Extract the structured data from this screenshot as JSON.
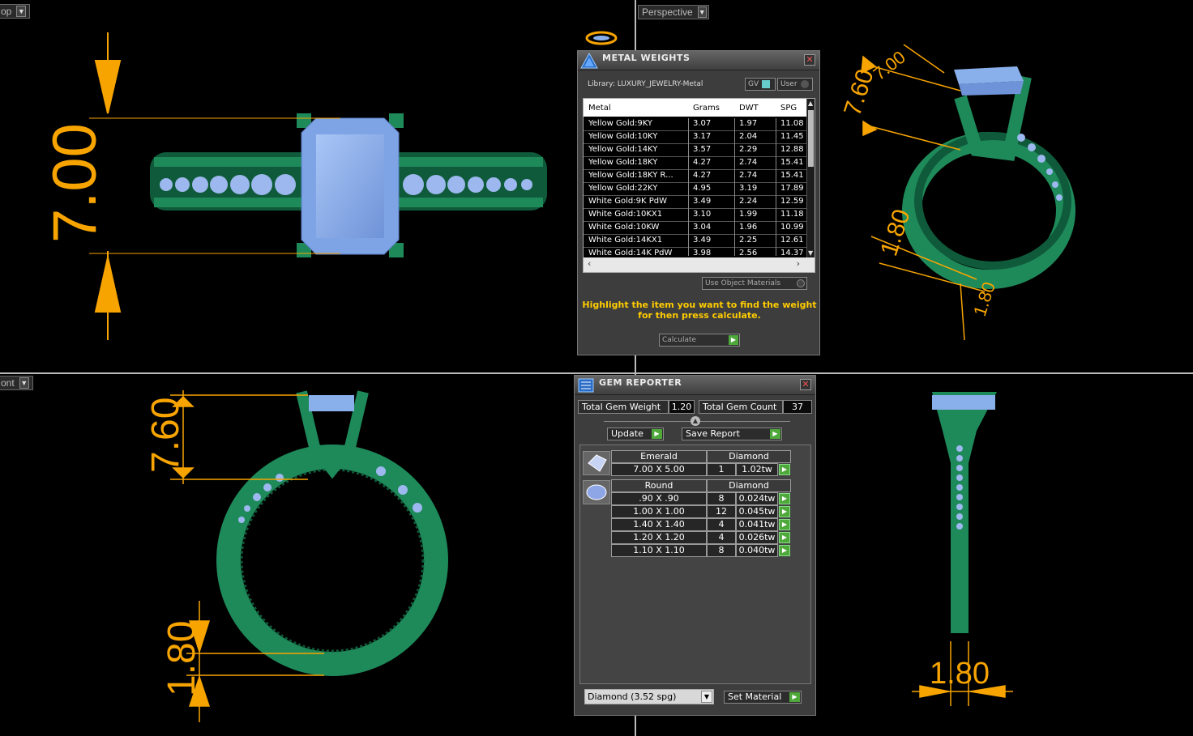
{
  "viewports": {
    "top_label": "op",
    "perspective_label": "Perspective",
    "front_label": "ont"
  },
  "dimensions": {
    "top_view": {
      "height": "7.00"
    },
    "perspective_view": {
      "top": "7.60",
      "top2": "7.00",
      "shank": "1.80",
      "base": "1.80"
    },
    "front_view": {
      "top": "7.60",
      "shank": "1.80"
    },
    "side_view": {
      "width": "1.80"
    }
  },
  "metal_weights": {
    "title": "METAL WEIGHTS",
    "library": "Library: LUXURY_JEWELRY-Metal",
    "toggle_gv": "GV",
    "toggle_user": "User",
    "columns": [
      "Metal",
      "Grams",
      "DWT",
      "SPG"
    ],
    "rows": [
      [
        "Yellow Gold:9KY",
        "3.07",
        "1.97",
        "11.08"
      ],
      [
        "Yellow Gold:10KY",
        "3.17",
        "2.04",
        "11.45"
      ],
      [
        "Yellow Gold:14KY",
        "3.57",
        "2.29",
        "12.88"
      ],
      [
        "Yellow Gold:18KY",
        "4.27",
        "2.74",
        "15.41"
      ],
      [
        "Yellow Gold:18KY R...",
        "4.27",
        "2.74",
        "15.41"
      ],
      [
        "Yellow Gold:22KY",
        "4.95",
        "3.19",
        "17.89"
      ],
      [
        "White Gold:9K PdW",
        "3.49",
        "2.24",
        "12.59"
      ],
      [
        "White Gold:10KX1",
        "3.10",
        "1.99",
        "11.18"
      ],
      [
        "White Gold:10KW",
        "3.04",
        "1.96",
        "10.99"
      ],
      [
        "White Gold:14KX1",
        "3.49",
        "2.25",
        "12.61"
      ],
      [
        "White Gold:14K PdW",
        "3.98",
        "2.56",
        "14.37"
      ]
    ],
    "use_object_materials": "Use Object Materials",
    "hint": "Highlight the item you want to find the weight for then press calculate.",
    "calculate": "Calculate"
  },
  "gem_reporter": {
    "title": "GEM REPORTER",
    "total_weight_label": "Total Gem Weight",
    "total_weight": "1.20",
    "total_count_label": "Total Gem Count",
    "total_count": "37",
    "update": "Update",
    "save_report": "Save Report",
    "groups": [
      {
        "shape": "Emerald",
        "material": "Diamond",
        "rows": [
          [
            "7.00 X 5.00",
            "1",
            "1.02tw"
          ]
        ]
      },
      {
        "shape": "Round",
        "material": "Diamond",
        "rows": [
          [
            ".90 X .90",
            "8",
            "0.024tw"
          ],
          [
            "1.00 X 1.00",
            "12",
            "0.045tw"
          ],
          [
            "1.40 X 1.40",
            "4",
            "0.041tw"
          ],
          [
            "1.20 X 1.20",
            "4",
            "0.026tw"
          ],
          [
            "1.10 X 1.10",
            "8",
            "0.040tw"
          ]
        ]
      }
    ],
    "material_select": "Diamond    (3.52 spg)",
    "set_material": "Set Material"
  },
  "colors": {
    "background": "#000000",
    "metal_green": "#1e8a5a",
    "gem_blue": "#8ab0ec",
    "dimension_orange": "#f7a400",
    "hint_yellow": "#ffcc00",
    "go_green": "#4ea83a"
  }
}
